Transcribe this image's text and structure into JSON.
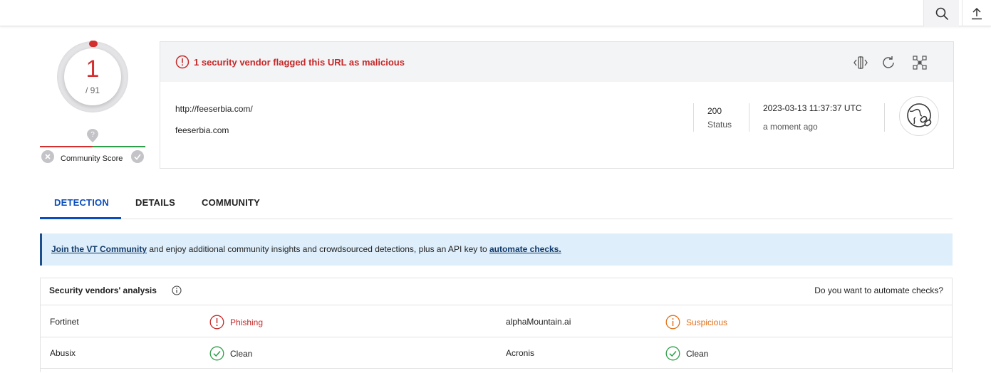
{
  "topbar": {
    "search_icon": "search-icon",
    "upload_icon": "upload-icon"
  },
  "score": {
    "detections": "1",
    "total": "/ 91",
    "community_label": "Community Score",
    "color": "#d32f2f"
  },
  "summary": {
    "alert": "1 security vendor flagged this URL as malicious",
    "url": "http://feeserbia.com/",
    "domain": "feeserbia.com",
    "status_code": "200",
    "status_label": "Status",
    "date": "2023-03-13 11:37:37 UTC",
    "ago": "a moment ago",
    "actions": [
      "compare-icon",
      "reanalyze-icon",
      "graph-icon"
    ]
  },
  "tabs": [
    {
      "label": "DETECTION",
      "active": true
    },
    {
      "label": "DETAILS",
      "active": false
    },
    {
      "label": "COMMUNITY",
      "active": false
    }
  ],
  "banner": {
    "link1": "Join the VT Community",
    "middle": " and enjoy additional community insights and crowdsourced detections, plus an API key to ",
    "link2": "automate checks."
  },
  "vendors": {
    "title": "Security vendors' analysis",
    "automate": "Do you want to automate checks?",
    "rows": [
      [
        {
          "name": "Fortinet",
          "result": "Phishing",
          "kind": "malicious"
        },
        {
          "name": "alphaMountain.ai",
          "result": "Suspicious",
          "kind": "suspicious"
        }
      ],
      [
        {
          "name": "Abusix",
          "result": "Clean",
          "kind": "clean"
        },
        {
          "name": "Acronis",
          "result": "Clean",
          "kind": "clean"
        }
      ]
    ]
  },
  "colors": {
    "accent": "#0b4dbd",
    "malicious": "#c62828",
    "suspicious": "#e0701a",
    "clean": "#2e9e4a"
  }
}
